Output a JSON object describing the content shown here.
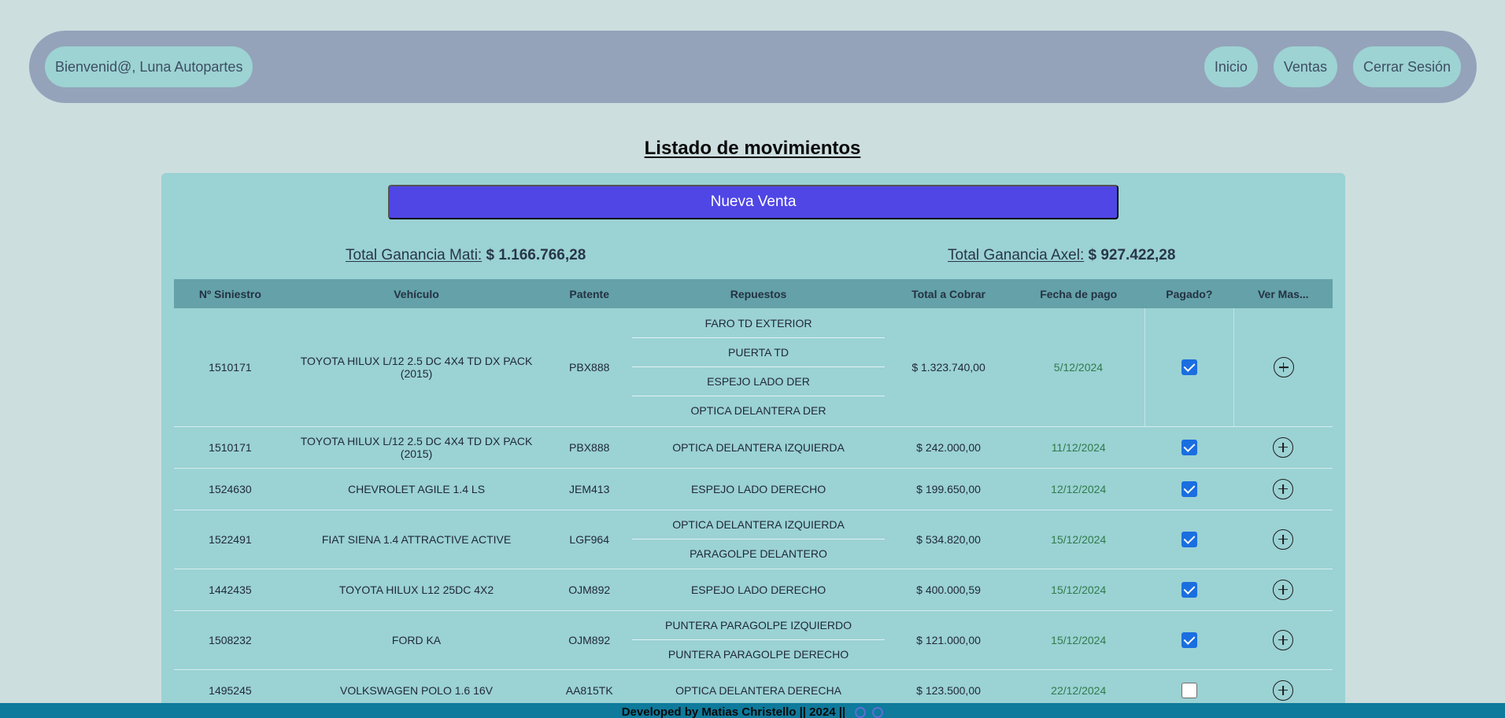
{
  "navbar": {
    "welcome": "Bienvenid@, Luna Autopartes",
    "links": [
      "Inicio",
      "Ventas",
      "Cerrar Sesión"
    ]
  },
  "page_title": "Listado de movimientos",
  "new_sale_label": "Nueva Venta",
  "totals": {
    "mati_label": "Total Ganancia Mati:",
    "mati_value": "$ 1.166.766,28",
    "axel_label": "Total Ganancia Axel:",
    "axel_value": "$ 927.422,28"
  },
  "table": {
    "headers": [
      "Nº Siniestro",
      "Vehículo",
      "Patente",
      "Repuestos",
      "Total a Cobrar",
      "Fecha de pago",
      "Pagado?",
      "Ver Mas..."
    ],
    "rows": [
      {
        "siniestro": "1510171",
        "vehiculo": "TOYOTA HILUX L/12 2.5 DC 4X4 TD DX PACK (2015)",
        "patente": "PBX888",
        "repuestos": [
          "FARO TD EXTERIOR",
          "PUERTA TD",
          "ESPEJO LADO DER",
          "OPTICA DELANTERA DER"
        ],
        "total": "$ 1.323.740,00",
        "fecha": "5/12/2024",
        "pagado": true
      },
      {
        "siniestro": "1510171",
        "vehiculo": "TOYOTA HILUX L/12 2.5 DC 4X4 TD DX PACK (2015)",
        "patente": "PBX888",
        "repuestos": [
          "OPTICA DELANTERA IZQUIERDA"
        ],
        "total": "$ 242.000,00",
        "fecha": "11/12/2024",
        "pagado": true
      },
      {
        "siniestro": "1524630",
        "vehiculo": "CHEVROLET AGILE 1.4 LS",
        "patente": "JEM413",
        "repuestos": [
          "ESPEJO LADO DERECHO"
        ],
        "total": "$ 199.650,00",
        "fecha": "12/12/2024",
        "pagado": true
      },
      {
        "siniestro": "1522491",
        "vehiculo": "FIAT SIENA 1.4 ATTRACTIVE ACTIVE",
        "patente": "LGF964",
        "repuestos": [
          "OPTICA DELANTERA IZQUIERDA",
          "PARAGOLPE DELANTERO"
        ],
        "total": "$ 534.820,00",
        "fecha": "15/12/2024",
        "pagado": true
      },
      {
        "siniestro": "1442435",
        "vehiculo": "TOYOTA HILUX L12 25DC 4X2",
        "patente": "OJM892",
        "repuestos": [
          "ESPEJO LADO DERECHO"
        ],
        "total": "$ 400.000,59",
        "fecha": "15/12/2024",
        "pagado": true
      },
      {
        "siniestro": "1508232",
        "vehiculo": "FORD KA",
        "patente": "OJM892",
        "repuestos": [
          "PUNTERA PARAGOLPE IZQUIERDO",
          "PUNTERA PARAGOLPE DERECHO"
        ],
        "total": "$ 121.000,00",
        "fecha": "15/12/2024",
        "pagado": true
      },
      {
        "siniestro": "1495245",
        "vehiculo": "VOLKSWAGEN POLO 1.6 16V",
        "patente": "AA815TK",
        "repuestos": [
          "OPTICA DELANTERA DERECHA"
        ],
        "total": "$ 123.500,00",
        "fecha": "22/12/2024",
        "pagado": false
      }
    ]
  },
  "footer": {
    "text": "Developed by Matias Christello || 2024 ||",
    "icons": [
      "github-icon",
      "linkedin-icon"
    ]
  },
  "colors": {
    "background": "#cddedf",
    "navbar": "#94a3ba",
    "pill": "#9dd3d3",
    "card": "#9bd2d4",
    "primary_button": "#4f46e5",
    "table_header": "#64a1a8",
    "date_text": "#2f7b4a",
    "footer": "#0e7a9c"
  }
}
